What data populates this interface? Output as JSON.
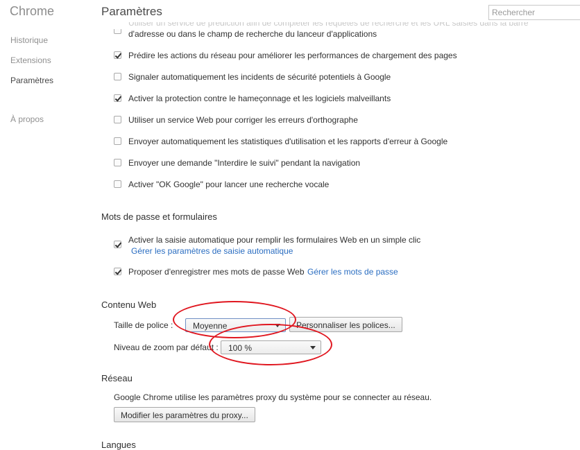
{
  "sidebar": {
    "brand": "Chrome",
    "items": [
      {
        "label": "Historique"
      },
      {
        "label": "Extensions"
      },
      {
        "label": "Paramètres"
      },
      {
        "label": "À propos"
      }
    ]
  },
  "header": {
    "title": "Paramètres",
    "search_placeholder": "Rechercher"
  },
  "privacy": {
    "partial_top": "Utiliser un service de prédiction afin de compléter les requêtes de recherche et les URL saisies dans la barre",
    "partial_line2": "d'adresse ou dans le champ de recherche du lanceur d'applications",
    "options": [
      {
        "label": "Prédire les actions du réseau pour améliorer les performances de chargement des pages",
        "checked": true
      },
      {
        "label": "Signaler automatiquement les incidents de sécurité potentiels à Google",
        "checked": false
      },
      {
        "label": "Activer la protection contre le hameçonnage et les logiciels malveillants",
        "checked": true
      },
      {
        "label": "Utiliser un service Web pour corriger les erreurs d'orthographe",
        "checked": false
      },
      {
        "label": "Envoyer automatiquement les statistiques d'utilisation et les rapports d'erreur à Google",
        "checked": false
      },
      {
        "label": "Envoyer une demande \"Interdire le suivi\" pendant la navigation",
        "checked": false
      },
      {
        "label": "Activer \"OK Google\" pour lancer une recherche vocale",
        "checked": false
      }
    ]
  },
  "passwords": {
    "heading": "Mots de passe et formulaires",
    "autofill_label": "Activer la saisie automatique pour remplir les formulaires Web en un simple clic",
    "autofill_link": "Gérer les paramètres de saisie automatique",
    "save_label": "Proposer d'enregistrer mes mots de passe Web",
    "save_link": "Gérer les mots de passe"
  },
  "web_content": {
    "heading": "Contenu Web",
    "font_size_label": "Taille de police :",
    "font_size_value": "Moyenne",
    "customize_fonts_button": "Personnaliser les polices...",
    "zoom_label": "Niveau de zoom par défaut :",
    "zoom_value": "100 %"
  },
  "network": {
    "heading": "Réseau",
    "description": "Google Chrome utilise les paramètres proxy du système pour se connecter au réseau.",
    "proxy_button": "Modifier les paramètres du proxy..."
  },
  "languages": {
    "heading": "Langues"
  },
  "colors": {
    "link": "#2a6dc1",
    "annotation": "#e0161f"
  }
}
